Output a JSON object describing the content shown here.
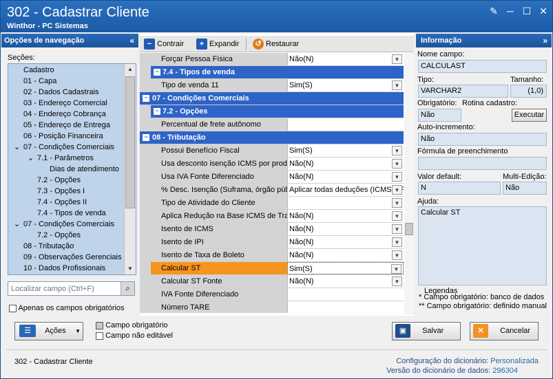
{
  "window": {
    "title": "302 - Cadastrar Cliente",
    "subtitle": "Winthor - PC Sistemas",
    "controls": {
      "edit": "✎",
      "minimize": "─",
      "maximize": "☐",
      "close": "✕"
    }
  },
  "nav": {
    "header": "Opções de navegação",
    "collapse": "«",
    "sections_label": "Seções:",
    "items": [
      {
        "label": "Cadastro"
      },
      {
        "label": "01 - Capa"
      },
      {
        "label": "02 - Dados Cadastrais"
      },
      {
        "label": "03 - Endereço Comercial"
      },
      {
        "label": "04 - Endereço Cobrança"
      },
      {
        "label": "05 - Endereço de Entrega"
      },
      {
        "label": "06 - Posição Financeira"
      },
      {
        "label": "07 - Condições Comerciais"
      },
      {
        "label": "7.1 - Parâmetros"
      },
      {
        "label": "Dias de atendimento"
      },
      {
        "label": "7.2 - Opções"
      },
      {
        "label": "7.3 - Opções I"
      },
      {
        "label": "7.4 - Opções II"
      },
      {
        "label": "7.4 - Tipos de venda"
      },
      {
        "label": "07 - Condições Comerciais"
      },
      {
        "label": "7.2 - Opções"
      },
      {
        "label": "08 - Tributação"
      },
      {
        "label": "09 - Observações Gerenciais"
      },
      {
        "label": "10 - Dados Profissionais"
      }
    ],
    "search_placeholder": "Localizar campo (Ctrl+F)",
    "required_only_label": "Apenas os campos obrigatórios"
  },
  "toolbar": {
    "collapse_label": "Contrair",
    "expand_label": "Expandir",
    "restore_label": "Restaurar"
  },
  "grid": {
    "rows": [
      {
        "type": "field",
        "name": "Forçar Pessoa Física",
        "value": "Não(N)",
        "dropdown": true
      },
      {
        "type": "subcat",
        "name": "7.4 - Tipos de venda"
      },
      {
        "type": "field",
        "name": "Tipo de venda 11",
        "value": "Sim(S)",
        "dropdown": true
      },
      {
        "type": "cat",
        "name": "07 - Condições Comerciais"
      },
      {
        "type": "subcat",
        "name": "7.2 - Opções"
      },
      {
        "type": "field",
        "name": "Percentual de frete autônomo",
        "value": "",
        "dropdown": false
      },
      {
        "type": "cat",
        "name": "08 - Tributação"
      },
      {
        "type": "field",
        "name": "Possui Benefício Fiscal",
        "value": "Sim(S)",
        "dropdown": true
      },
      {
        "type": "field",
        "name": "Usa desconto isenção ICMS por produto",
        "value": "Não(N)",
        "dropdown": true
      },
      {
        "type": "field",
        "name": "Usa IVA Fonte Diferenciado",
        "value": "Não(N)",
        "dropdown": true
      },
      {
        "type": "field",
        "name": "% Desc. Isenção (Suframa, órgão público)",
        "value": "Aplicar todas deduções (ICMS e PIS/COFINS)",
        "dropdown": true
      },
      {
        "type": "field",
        "name": "Tipo de Atividade do Cliente",
        "value": "",
        "dropdown": true
      },
      {
        "type": "field",
        "name": "Aplica Redução na Base ICMS de Transferência",
        "value": "Não(N)",
        "dropdown": true
      },
      {
        "type": "field",
        "name": "Isento de ICMS",
        "value": "Não(N)",
        "dropdown": true
      },
      {
        "type": "field",
        "name": "Isento de IPI",
        "value": "Não(N)",
        "dropdown": true
      },
      {
        "type": "field",
        "name": "Isento de Taxa de Boleto",
        "value": "Não(N)",
        "dropdown": true
      },
      {
        "type": "field",
        "name": "Calcular ST",
        "value": "Sim(S)",
        "dropdown": true,
        "selected": true
      },
      {
        "type": "field",
        "name": "Calcular ST Fonte",
        "value": "Não(N)",
        "dropdown": true
      },
      {
        "type": "field",
        "name": "IVA Fonte Diferenciado",
        "value": "",
        "dropdown": false
      },
      {
        "type": "field",
        "name": "Número TARE",
        "value": "",
        "dropdown": false
      }
    ]
  },
  "info": {
    "header": "Informação",
    "collapse": "»",
    "field_name_label": "Nome campo:",
    "field_name": "CALCULAST",
    "type_label": "Tipo:",
    "type": "VARCHAR2",
    "size_label": "Tamanho:",
    "size": "(1,0)",
    "required_label": "Obrigatório:",
    "required": "Não",
    "routine_label": "Rotina cadastro:",
    "execute_label": "Executar",
    "autoinc_label": "Auto-incremento:",
    "autoinc": "Não",
    "formula_label": "Fórmula de preenchimento",
    "formula": "",
    "default_label": "Valor default:",
    "default": "N",
    "multiedit_label": "Multi-Edição:",
    "multiedit": "Não",
    "help_label": "Ajuda:",
    "help": "Calcular ST",
    "legend_title": "Legendas",
    "legend_1": "* Campo obrigatório: banco de dados",
    "legend_2": "** Campo obrigatório: definido manual"
  },
  "bottom": {
    "actions_label": "Ações",
    "legend_required": "Campo obrigatório",
    "legend_readonly": "Campo não editável",
    "save_label": "Salvar",
    "cancel_label": "Cancelar",
    "footer_title": "302 - Cadastrar Cliente",
    "dict_config_label": "Configuração do dicionário:",
    "dict_config_value": "Personalizada",
    "dict_version_label": "Versão do dicionário de dados:",
    "dict_version_value": "296304"
  },
  "colors": {
    "title_bar": "#1c5aa6",
    "category": "#2e63c8",
    "selected_row": "#f7941d",
    "tree_bg": "#bfd3ea"
  }
}
